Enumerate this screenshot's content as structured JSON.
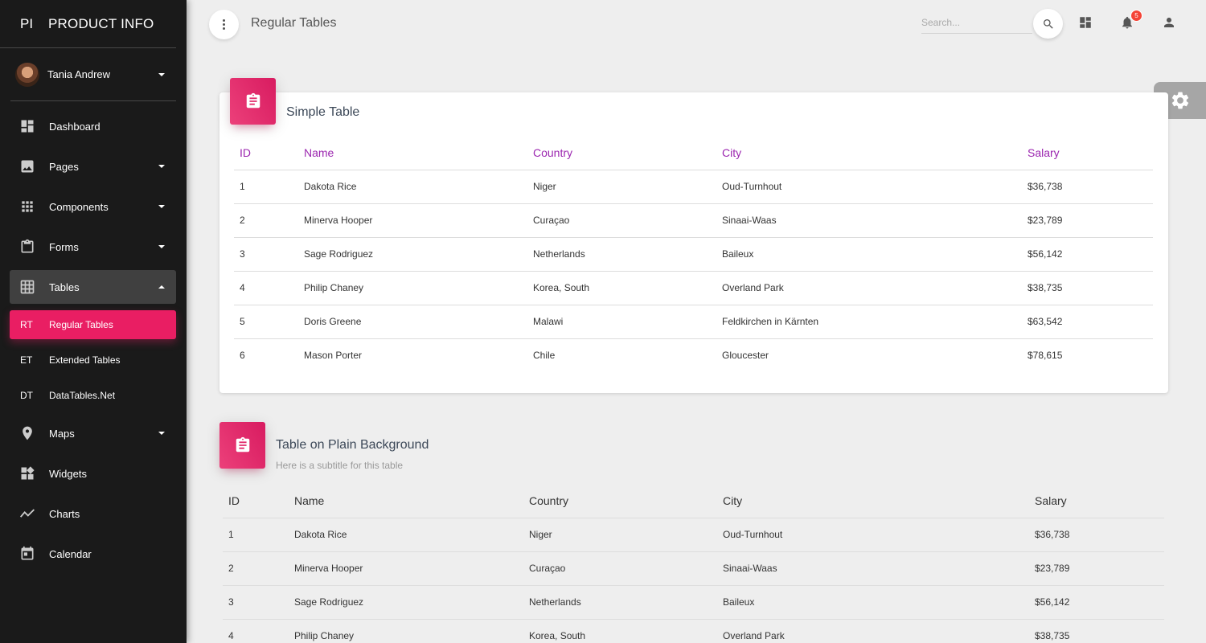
{
  "brand": {
    "mini": "PI",
    "full": "PRODUCT INFO"
  },
  "user": {
    "name": "Tania Andrew"
  },
  "sidebar": {
    "items": [
      {
        "label": "Dashboard"
      },
      {
        "label": "Pages"
      },
      {
        "label": "Components"
      },
      {
        "label": "Forms"
      },
      {
        "label": "Tables"
      },
      {
        "label": "Maps"
      },
      {
        "label": "Widgets"
      },
      {
        "label": "Charts"
      },
      {
        "label": "Calendar"
      }
    ],
    "subitems": [
      {
        "abbr": "RT",
        "label": "Regular Tables"
      },
      {
        "abbr": "ET",
        "label": "Extended Tables"
      },
      {
        "abbr": "DT",
        "label": "DataTables.Net"
      }
    ]
  },
  "header": {
    "title": "Regular Tables",
    "search_placeholder": "Search...",
    "notification_count": "5"
  },
  "simple_table": {
    "title": "Simple Table",
    "columns": [
      "ID",
      "Name",
      "Country",
      "City",
      "Salary"
    ],
    "rows": [
      [
        "1",
        "Dakota Rice",
        "Niger",
        "Oud-Turnhout",
        "$36,738"
      ],
      [
        "2",
        "Minerva Hooper",
        "Curaçao",
        "Sinaai-Waas",
        "$23,789"
      ],
      [
        "3",
        "Sage Rodriguez",
        "Netherlands",
        "Baileux",
        "$56,142"
      ],
      [
        "4",
        "Philip Chaney",
        "Korea, South",
        "Overland Park",
        "$38,735"
      ],
      [
        "5",
        "Doris Greene",
        "Malawi",
        "Feldkirchen in Kärnten",
        "$63,542"
      ],
      [
        "6",
        "Mason Porter",
        "Chile",
        "Gloucester",
        "$78,615"
      ]
    ]
  },
  "plain_table": {
    "title": "Table on Plain Background",
    "subtitle": "Here is a subtitle for this table",
    "columns": [
      "ID",
      "Name",
      "Country",
      "City",
      "Salary"
    ],
    "rows": [
      [
        "1",
        "Dakota Rice",
        "Niger",
        "Oud-Turnhout",
        "$36,738"
      ],
      [
        "2",
        "Minerva Hooper",
        "Curaçao",
        "Sinaai-Waas",
        "$23,789"
      ],
      [
        "3",
        "Sage Rodriguez",
        "Netherlands",
        "Baileux",
        "$56,142"
      ],
      [
        "4",
        "Philip Chaney",
        "Korea, South",
        "Overland Park",
        "$38,735"
      ]
    ]
  },
  "colors": {
    "accent": "#e91e63",
    "header_purple": "#9c27b0",
    "sidebar_bg": "#1a1a1a",
    "badge_red": "#f44336"
  },
  "icons": [
    "dashboard-icon",
    "image-icon",
    "apps-icon",
    "clipboard-icon",
    "grid-on-icon",
    "place-icon",
    "widgets-icon",
    "timeline-icon",
    "calendar-icon",
    "search-icon",
    "view-quilt-icon",
    "notifications-icon",
    "person-icon",
    "settings-icon",
    "assignment-icon"
  ]
}
